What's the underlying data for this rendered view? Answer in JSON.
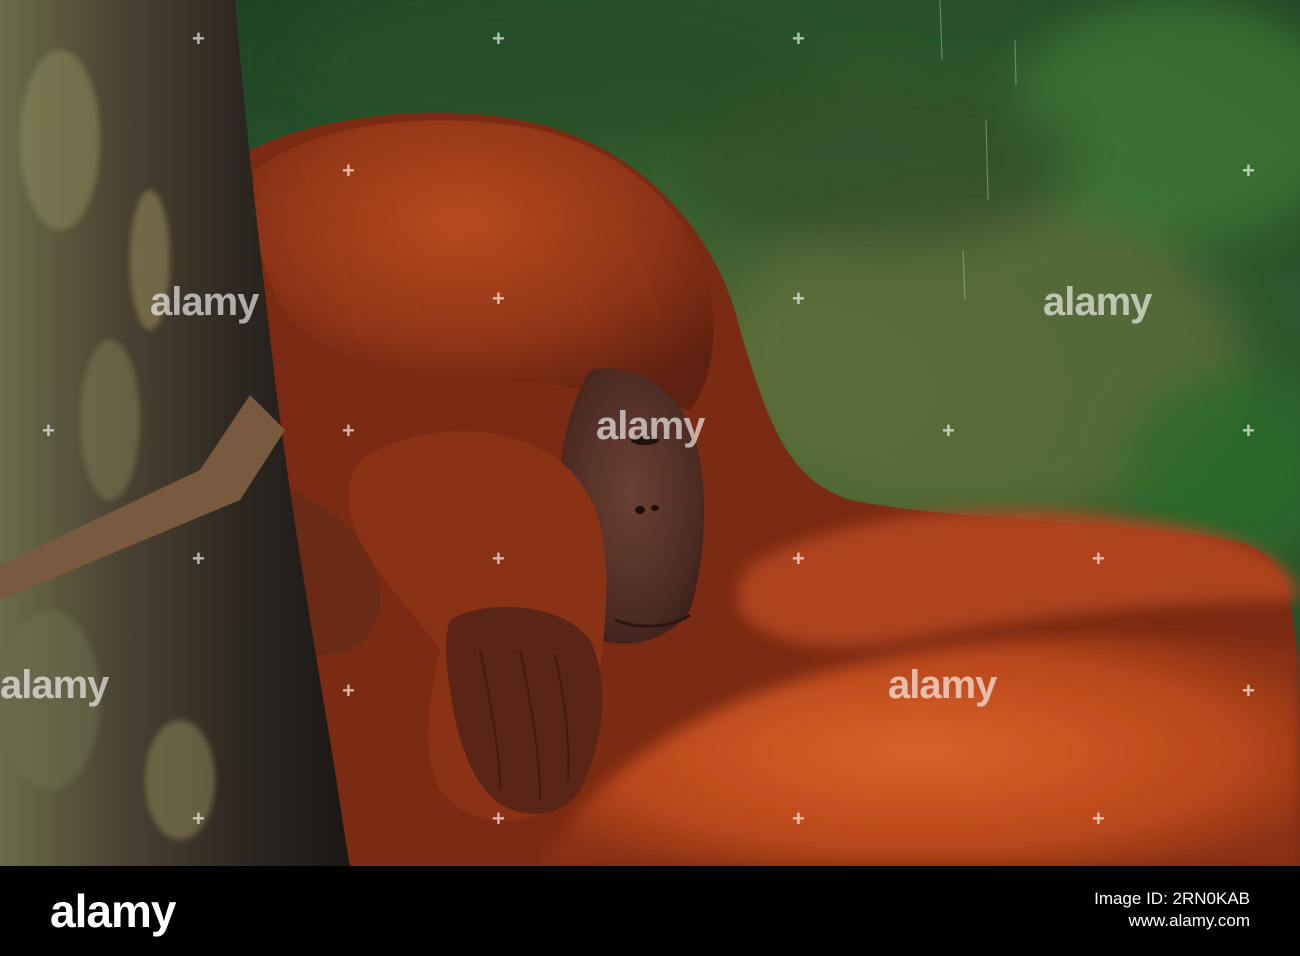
{
  "photo": {
    "subject": "orangutan-resting-against-tree",
    "palette": {
      "background_green": "#2f5a2e",
      "fur_orange": "#c4521f",
      "fur_dark": "#7a2a14",
      "bark": "#3b3126"
    }
  },
  "watermark": {
    "text": "alamy"
  },
  "footer": {
    "logo": "alamy",
    "image_id": "Image ID: 2RN0KAB",
    "url": "www.alamy.com"
  }
}
